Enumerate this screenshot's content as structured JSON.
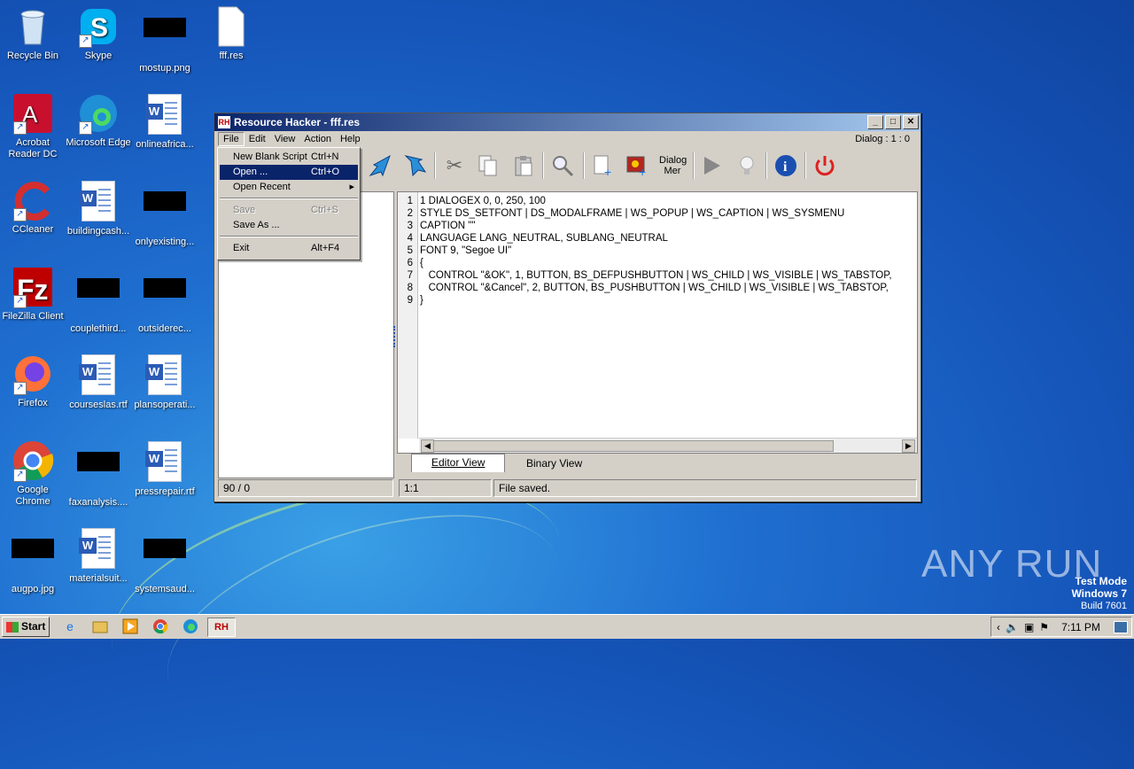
{
  "desktop": {
    "icons": [
      {
        "label": "Recycle Bin",
        "icon": "recycle-bin-icon"
      },
      {
        "label": "Skype",
        "icon": "skype-icon"
      },
      {
        "label": "mostup.png",
        "icon": "image-file-icon"
      },
      {
        "label": "fff.res",
        "icon": "file-icon"
      },
      {
        "label": "Acrobat Reader DC",
        "icon": "acrobat-icon"
      },
      {
        "label": "Microsoft Edge",
        "icon": "edge-icon"
      },
      {
        "label": "onlineafrica...",
        "icon": "word-doc-icon"
      },
      {
        "label": "CCleaner",
        "icon": "ccleaner-icon"
      },
      {
        "label": "buildingcash...",
        "icon": "word-doc-icon"
      },
      {
        "label": "onlyexisting...",
        "icon": "image-file-icon"
      },
      {
        "label": "FileZilla Client",
        "icon": "filezilla-icon"
      },
      {
        "label": "couplethird...",
        "icon": "image-file-icon"
      },
      {
        "label": "outsiderec...",
        "icon": "image-file-icon"
      },
      {
        "label": "Firefox",
        "icon": "firefox-icon"
      },
      {
        "label": "courseslas.rtf",
        "icon": "word-doc-icon"
      },
      {
        "label": "plansoperati...",
        "icon": "word-doc-icon"
      },
      {
        "label": "Google Chrome",
        "icon": "chrome-icon"
      },
      {
        "label": "faxanalysis....",
        "icon": "image-file-icon"
      },
      {
        "label": "pressrepair.rtf",
        "icon": "word-doc-icon"
      },
      {
        "label": "augpo.jpg",
        "icon": "image-file-icon"
      },
      {
        "label": "materialsuit...",
        "icon": "word-doc-icon"
      },
      {
        "label": "systemsaud...",
        "icon": "image-file-icon"
      }
    ]
  },
  "window": {
    "title": "Resource Hacker - fff.res",
    "app_icon_text": "RH",
    "menu": [
      "File",
      "Edit",
      "View",
      "Action",
      "Help"
    ],
    "dialog_indicator": "Dialog : 1 : 0",
    "toolbar": {
      "dialog_merge_label": "Dialog Mer"
    },
    "editor": {
      "lines": [
        "1 DIALOGEX 0, 0, 250, 100",
        "STYLE DS_SETFONT | DS_MODALFRAME | WS_POPUP | WS_CAPTION | WS_SYSMENU",
        "CAPTION \"\"",
        "LANGUAGE LANG_NEUTRAL, SUBLANG_NEUTRAL",
        "FONT 9, \"Segoe UI\"",
        "{",
        "   CONTROL \"&OK\", 1, BUTTON, BS_DEFPUSHBUTTON | WS_CHILD | WS_VISIBLE | WS_TABSTOP,",
        "   CONTROL \"&Cancel\", 2, BUTTON, BS_PUSHBUTTON | WS_CHILD | WS_VISIBLE | WS_TABSTOP,",
        "}"
      ],
      "line_numbers": [
        "1",
        "2",
        "3",
        "4",
        "5",
        "6",
        "7",
        "8",
        "9"
      ]
    },
    "tabs": [
      "Editor View",
      "Binary View"
    ],
    "status": {
      "left": "90 / 0",
      "position": "1:1",
      "message": "File saved."
    }
  },
  "file_menu": {
    "items": [
      {
        "label": "New Blank Script",
        "shortcut": "Ctrl+N",
        "state": "normal"
      },
      {
        "label": "Open ...",
        "shortcut": "Ctrl+O",
        "state": "highlighted"
      },
      {
        "label": "Open Recent",
        "shortcut": "▸",
        "state": "normal"
      },
      {
        "label": "Save",
        "shortcut": "Ctrl+S",
        "state": "disabled"
      },
      {
        "label": "Save As ...",
        "shortcut": "",
        "state": "normal"
      },
      {
        "label": "Exit",
        "shortcut": "Alt+F4",
        "state": "normal"
      }
    ]
  },
  "taskbar": {
    "start_label": "Start",
    "clock": "7:11 PM"
  },
  "watermark": {
    "line1": "Test Mode",
    "line2": "Windows 7",
    "line3": "Build 7601",
    "brand": "ANY RUN"
  }
}
